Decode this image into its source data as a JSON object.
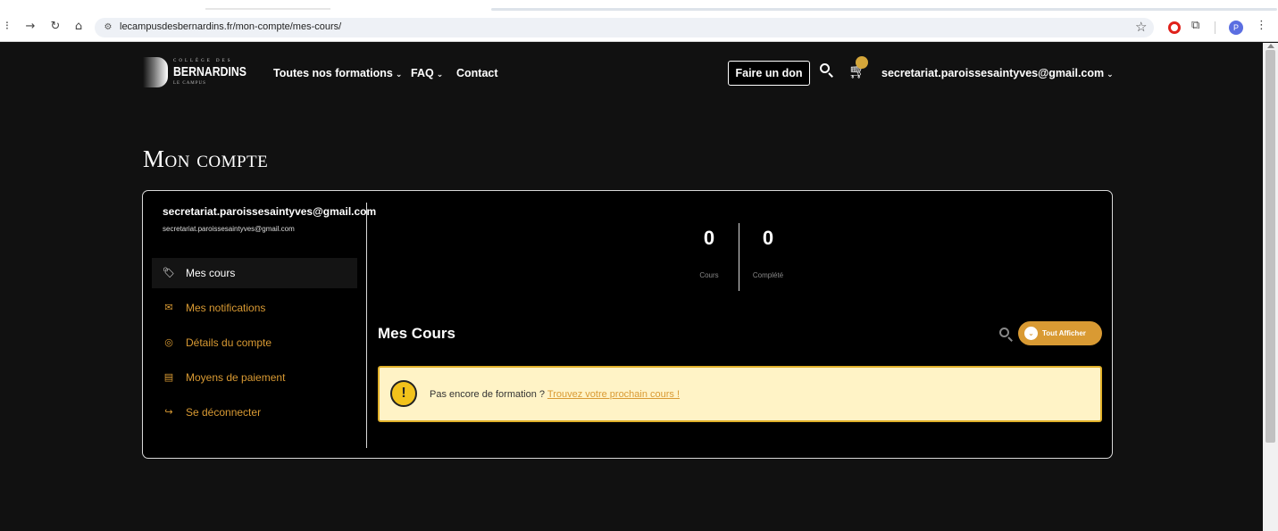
{
  "browser": {
    "url": "lecampusdesbernardins.fr/mon-compte/mes-cours/",
    "profile_initial": "P",
    "nav": {
      "back": "←",
      "forward": "→",
      "reload": "↻",
      "home": "⌂"
    }
  },
  "header": {
    "logo": {
      "top": "COLLÈGE DES",
      "brand": "BERNARDINS",
      "sub": "LE CAMPUS"
    },
    "nav_items": [
      "Toutes nos formations",
      "FAQ",
      "Contact"
    ],
    "donate_label": "Faire un don",
    "cart_count": "",
    "user_email": "secretariat.paroissesaintyves@gmail.com"
  },
  "page": {
    "title": "Mon compte"
  },
  "account": {
    "name": "secretariat.paroissesaintyves@gmail.com",
    "email": "secretariat.paroissesaintyves@gmail.com",
    "menu": [
      {
        "label": "Mes cours",
        "icon": "tag-icon",
        "active": true
      },
      {
        "label": "Mes notifications",
        "icon": "mail-icon",
        "active": false
      },
      {
        "label": "Détails du compte",
        "icon": "user-circle-icon",
        "active": false
      },
      {
        "label": "Moyens de paiement",
        "icon": "credit-card-icon",
        "active": false
      },
      {
        "label": "Se déconnecter",
        "icon": "logout-icon",
        "active": false
      }
    ]
  },
  "stats": [
    {
      "value": "0",
      "label": "Cours"
    },
    {
      "value": "0",
      "label": "Complété"
    }
  ],
  "courses": {
    "title": "Mes Cours",
    "filter_label": "Tout Afficher",
    "notice_text": "Pas encore de formation ?",
    "notice_link": "Trouvez votre prochain cours !"
  },
  "colors": {
    "accent": "#d99a33",
    "notice_bg": "#fff3c6",
    "background": "#111111"
  }
}
